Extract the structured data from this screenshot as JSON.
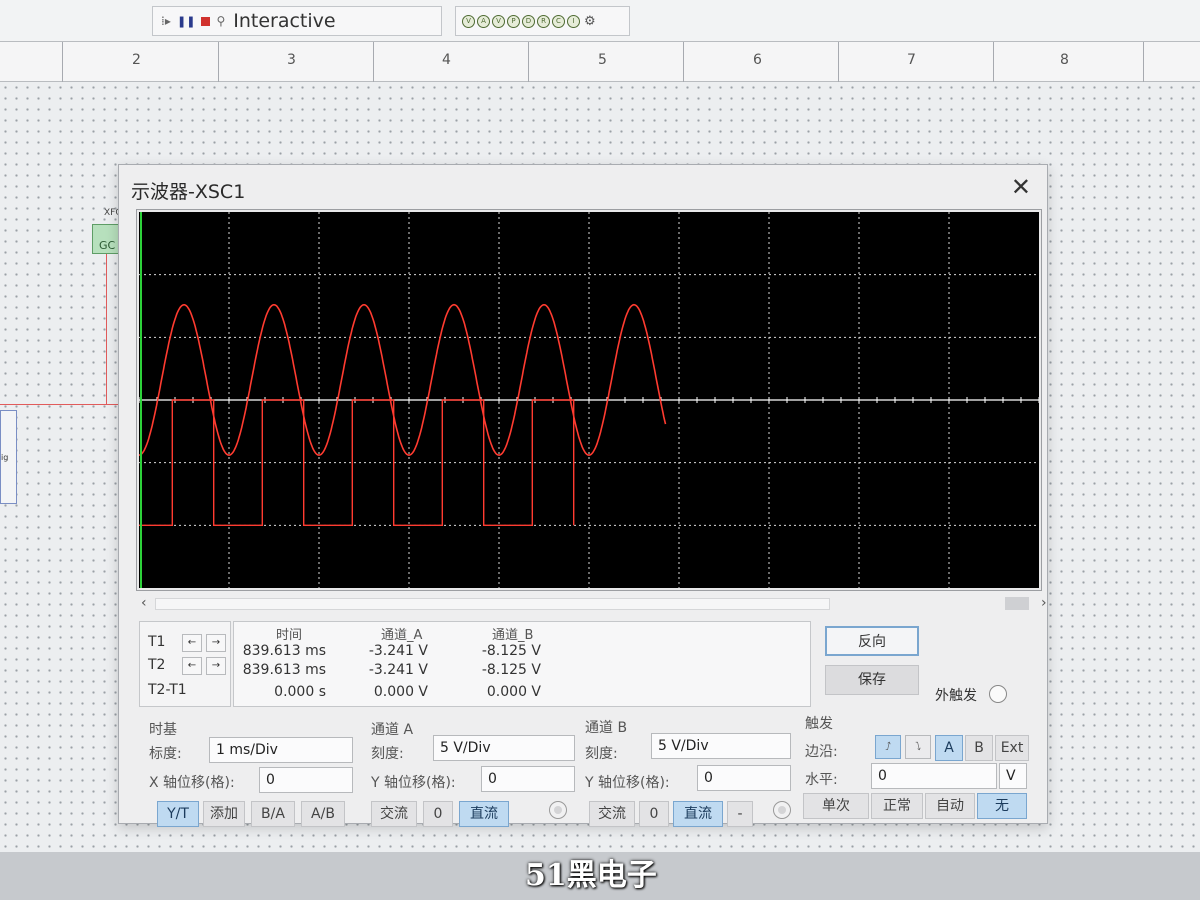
{
  "toolbar": {
    "mode": "Interactive",
    "icons": [
      "grip-icon",
      "pause-icon",
      "stop-icon",
      "tool-icon"
    ],
    "probe_icons": [
      "probe-icon",
      "probe-icon",
      "probe-icon",
      "probe-icon",
      "probe-icon",
      "probe-icon",
      "probe-icon",
      "probe-icon",
      "gear-icon"
    ]
  },
  "ruler": {
    "labels": [
      "2",
      "3",
      "4",
      "5",
      "6",
      "7",
      "8"
    ]
  },
  "schematic": {
    "xfg_label": "XFG",
    "gc_label": "GC",
    "side_label": "ig"
  },
  "scope": {
    "title": "示波器-XSC1",
    "close": "✕",
    "colors": {
      "screen_bg": "#000000",
      "grid": "#d9d9d9",
      "trace_a": "#ff3b30",
      "trace_b": "#ff3b30",
      "axis_marker": "#2dd23a"
    }
  },
  "chart_data": {
    "type": "line",
    "xlabel": "",
    "ylabel": "",
    "grid": true,
    "divisions": {
      "x": 10,
      "y": 6
    },
    "time_per_div_ms": 1,
    "volts_per_div": 5,
    "xlim": [
      0,
      10
    ],
    "ylim": [
      -15,
      15
    ],
    "series": [
      {
        "name": "通道_A",
        "shape": "sine",
        "amplitude_v": 10,
        "offset_v": 0,
        "period_ms": 1,
        "start_ms": 0,
        "end_ms": 5.85
      },
      {
        "name": "通道_B",
        "shape": "clipped",
        "high_v": 0,
        "low_v": -10,
        "period_ms": 1,
        "start_ms": 0,
        "end_ms": 5.35
      }
    ]
  },
  "cursors": {
    "t1": "T1",
    "t2": "T2",
    "diff": "T2-T1",
    "left_arrow": "←",
    "right_arrow": "→"
  },
  "measure": {
    "head_time": "时间",
    "head_a": "通道_A",
    "head_b": "通道_B",
    "rows": [
      {
        "time": "839.613 ms",
        "a": "-3.241 V",
        "b": "-8.125 V"
      },
      {
        "time": "839.613 ms",
        "a": "-3.241 V",
        "b": "-8.125 V"
      },
      {
        "time": "0.000 s",
        "a": "0.000 V",
        "b": "0.000 V"
      }
    ]
  },
  "buttons": {
    "reverse": "反向",
    "save": "保存",
    "ext_trigger": "外触发"
  },
  "timebase": {
    "title": "时基",
    "scale_label": "标度:",
    "scale": "1 ms/Div",
    "xpos_label": "X 轴位移(格):",
    "xpos": "0",
    "modes": [
      "Y/T",
      "添加",
      "B/A",
      "A/B"
    ],
    "active_mode": "Y/T"
  },
  "channel_a": {
    "title": "通道 A",
    "scale_label": "刻度:",
    "scale": "5  V/Div",
    "ypos_label": "Y 轴位移(格):",
    "ypos": "0",
    "coupling": [
      "交流",
      "0",
      "直流"
    ],
    "active": "直流"
  },
  "channel_b": {
    "title": "通道 B",
    "scale_label": "刻度:",
    "scale": "5  V/Div",
    "ypos_label": "Y 轴位移(格):",
    "ypos": "0",
    "coupling": [
      "交流",
      "0",
      "直流",
      "-"
    ],
    "active": "直流"
  },
  "trigger": {
    "title": "触发",
    "edge_label": "边沿:",
    "level_label": "水平:",
    "level": "0",
    "level_unit": "V",
    "sources": [
      "A",
      "B",
      "Ext"
    ],
    "active_source": "A",
    "modes": [
      "单次",
      "正常",
      "自动",
      "无"
    ],
    "active_mode": "无",
    "edge_rise": "⭜",
    "edge_fall": "⭝"
  },
  "watermark": "51黑电子"
}
